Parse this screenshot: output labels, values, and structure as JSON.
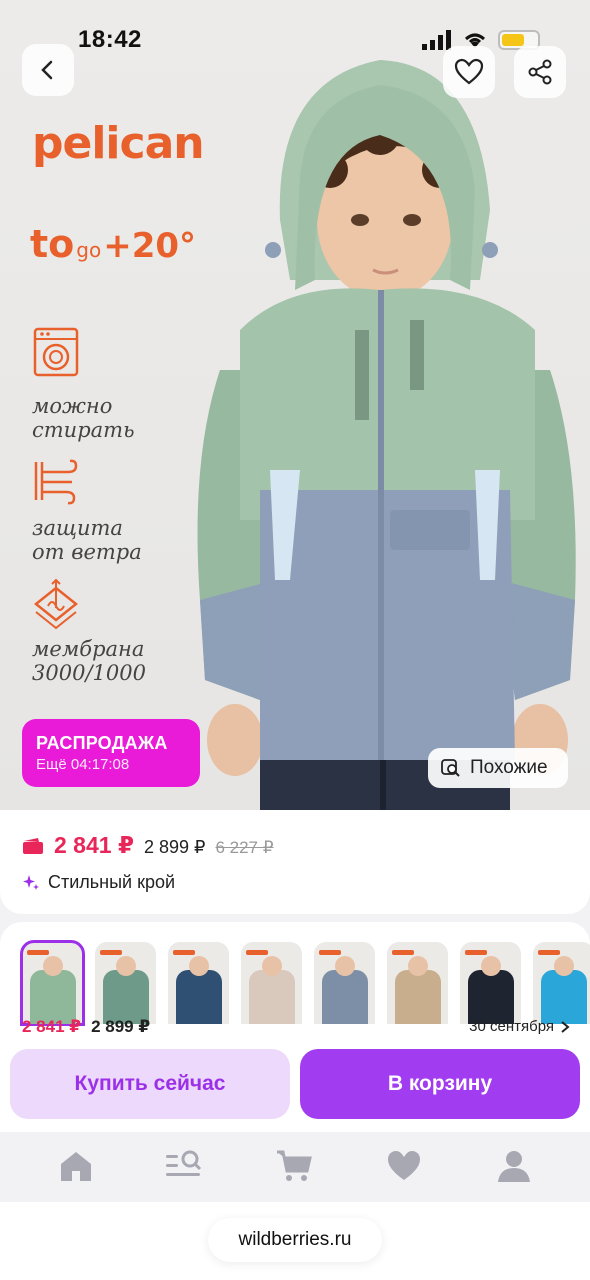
{
  "status_bar": {
    "time": "18:42"
  },
  "hero": {
    "brand": "pelican",
    "temperature": {
      "t": "to",
      "go": "go",
      "value": "+20°"
    },
    "features": [
      {
        "icon": "washing-machine-icon",
        "line1": "можно",
        "line2": "стирать"
      },
      {
        "icon": "wind-icon",
        "line1": "защита",
        "line2": "от ветра"
      },
      {
        "icon": "membrane-icon",
        "line1": "мембрана",
        "line2": "3000/1000"
      }
    ],
    "sale": {
      "title": "РАСПРОДАЖА",
      "timer": "Ещё 04:17:08"
    },
    "similar_label": "Похожие"
  },
  "price": {
    "current": "2 841 ₽",
    "secondary": "2 899 ₽",
    "old": "6 227 ₽",
    "feature": "Стильный крой"
  },
  "thumbnails": [
    {
      "jacket_color": "#8fb79a",
      "selected": true
    },
    {
      "jacket_color": "#6e9a8a",
      "selected": false
    },
    {
      "jacket_color": "#2f4f73",
      "selected": false
    },
    {
      "jacket_color": "#d8c9bc",
      "selected": false
    },
    {
      "jacket_color": "#7d8fa6",
      "selected": false
    },
    {
      "jacket_color": "#c8ae8c",
      "selected": false
    },
    {
      "jacket_color": "#1e2430",
      "selected": false
    },
    {
      "jacket_color": "#2aa6d8",
      "selected": false
    }
  ],
  "bottom_bar": {
    "price": "2 841 ₽",
    "price_secondary": "2 899 ₽",
    "delivery": "30 сентября",
    "buy_now": "Купить сейчас",
    "add_to_cart": "В корзину"
  },
  "nav": [
    "home-icon",
    "catalog-search-icon",
    "cart-icon",
    "favorites-heart-icon",
    "profile-icon"
  ],
  "browser": {
    "url": "wildberries.ru"
  },
  "colors": {
    "brand_orange": "#e8602c",
    "sale_pink": "#e91ad8",
    "price_red": "#e8265a",
    "accent_purple": "#a23cf0",
    "accent_purple_light": "#ecd9fb"
  }
}
